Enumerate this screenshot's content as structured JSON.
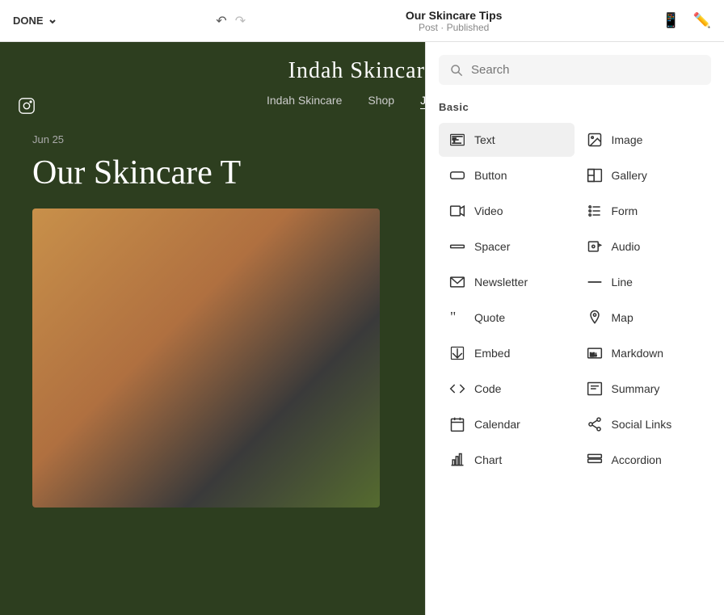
{
  "topbar": {
    "done_label": "DONE",
    "title": "Our Skincare Tips",
    "subtitle": "Post · Published"
  },
  "site": {
    "logo": "Indah Skincare",
    "nav": [
      "Indah Skincare",
      "Shop",
      "Journal"
    ],
    "blog_date": "Jun 25",
    "blog_title": "Our Skincare T"
  },
  "panel": {
    "search_placeholder": "Search",
    "section_basic": "Basic",
    "items_left": [
      {
        "id": "text",
        "label": "Text",
        "icon": "text-icon"
      },
      {
        "id": "button",
        "label": "Button",
        "icon": "button-icon"
      },
      {
        "id": "video",
        "label": "Video",
        "icon": "video-icon"
      },
      {
        "id": "spacer",
        "label": "Spacer",
        "icon": "spacer-icon"
      },
      {
        "id": "newsletter",
        "label": "Newsletter",
        "icon": "newsletter-icon"
      },
      {
        "id": "quote",
        "label": "Quote",
        "icon": "quote-icon"
      },
      {
        "id": "embed",
        "label": "Embed",
        "icon": "embed-icon"
      },
      {
        "id": "code",
        "label": "Code",
        "icon": "code-icon"
      },
      {
        "id": "calendar",
        "label": "Calendar",
        "icon": "calendar-icon"
      },
      {
        "id": "chart",
        "label": "Chart",
        "icon": "chart-icon"
      }
    ],
    "items_right": [
      {
        "id": "image",
        "label": "Image",
        "icon": "image-icon"
      },
      {
        "id": "gallery",
        "label": "Gallery",
        "icon": "gallery-icon"
      },
      {
        "id": "form",
        "label": "Form",
        "icon": "form-icon"
      },
      {
        "id": "audio",
        "label": "Audio",
        "icon": "audio-icon"
      },
      {
        "id": "line",
        "label": "Line",
        "icon": "line-icon"
      },
      {
        "id": "map",
        "label": "Map",
        "icon": "map-icon"
      },
      {
        "id": "markdown",
        "label": "Markdown",
        "icon": "markdown-icon"
      },
      {
        "id": "summary",
        "label": "Summary",
        "icon": "summary-icon"
      },
      {
        "id": "social-links",
        "label": "Social Links",
        "icon": "social-links-icon"
      },
      {
        "id": "accordion",
        "label": "Accordion",
        "icon": "accordion-icon"
      }
    ]
  }
}
